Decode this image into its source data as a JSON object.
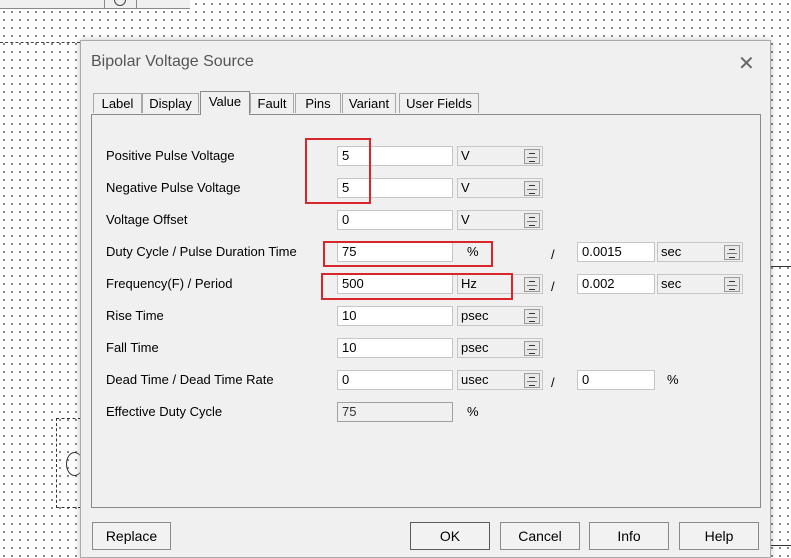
{
  "dialog": {
    "title": "Bipolar Voltage Source",
    "close_glyph": "✕"
  },
  "tabs": [
    "Label",
    "Display",
    "Value",
    "Fault",
    "Pins",
    "Variant",
    "User Fields"
  ],
  "active_tab": "Value",
  "fields": {
    "positive_pulse_voltage": {
      "label": "Positive Pulse Voltage",
      "value": "5",
      "unit": "V"
    },
    "negative_pulse_voltage": {
      "label": "Negative Pulse Voltage",
      "value": "5",
      "unit": "V"
    },
    "voltage_offset": {
      "label": "Voltage Offset",
      "value": "0",
      "unit": "V"
    },
    "duty_cycle": {
      "label": "Duty Cycle / Pulse Duration Time",
      "value": "75",
      "unit": "%",
      "time_value": "0.0015",
      "time_unit": "sec"
    },
    "frequency": {
      "label": "Frequency(F) / Period",
      "value": "500",
      "unit": "Hz",
      "period_value": "0.002",
      "period_unit": "sec"
    },
    "rise_time": {
      "label": "Rise Time",
      "value": "10",
      "unit": "psec"
    },
    "fall_time": {
      "label": "Fall Time",
      "value": "10",
      "unit": "psec"
    },
    "dead_time": {
      "label": "Dead Time / Dead Time Rate",
      "value": "0",
      "unit": "usec",
      "rate_value": "0",
      "rate_unit": "%"
    },
    "effective_duty_cycle": {
      "label": "Effective Duty Cycle",
      "value": "75",
      "unit": "%"
    }
  },
  "separator": "/",
  "buttons": {
    "replace": "Replace",
    "ok": "OK",
    "cancel": "Cancel",
    "info": "Info",
    "help": "Help"
  },
  "colors": {
    "highlight_box": "#d9262b",
    "dialog_bg": "#f0f0f0"
  }
}
